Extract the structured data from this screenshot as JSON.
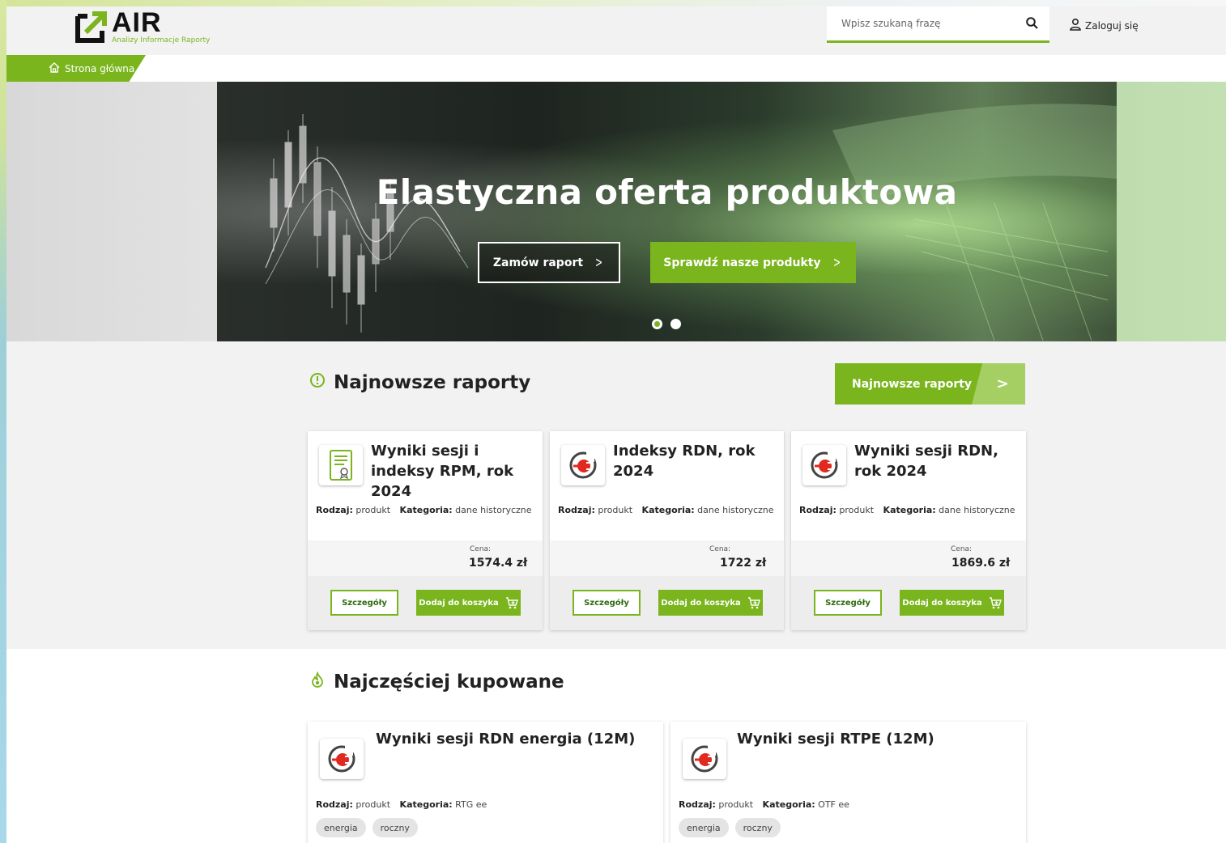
{
  "header": {
    "logo_name": "AIR",
    "logo_tagline": "Analizy Informacje Raporty",
    "search_placeholder": "Wpisz szukaną frazę",
    "login_label": "Zaloguj się"
  },
  "breadcrumb": {
    "home_label": "Strona główna"
  },
  "hero": {
    "title": "Elastyczna oferta produktowa",
    "button_outline": "Zamów raport",
    "button_green": "Sprawdź nasze produkty",
    "slides": 2,
    "active_slide": 1
  },
  "latest": {
    "title": "Najnowsze raporty",
    "button_label": "Najnowsze raporty",
    "cards": [
      {
        "title": "Wyniki sesji i indeksy RPM, rok 2024",
        "icon": "certificate-document-icon",
        "type_label": "Rodzaj:",
        "type_value": "produkt",
        "category_label": "Kategoria:",
        "category_value": "dane historyczne",
        "price_label": "Cena:",
        "price": "1574.4 zł",
        "details_label": "Szczegóły",
        "cart_label": "Dodaj do koszyka"
      },
      {
        "title": "Indeksy RDN, rok 2024",
        "icon": "power-plug-icon",
        "type_label": "Rodzaj:",
        "type_value": "produkt",
        "category_label": "Kategoria:",
        "category_value": "dane historyczne",
        "price_label": "Cena:",
        "price": "1722 zł",
        "details_label": "Szczegóły",
        "cart_label": "Dodaj do koszyka"
      },
      {
        "title": "Wyniki sesji RDN, rok 2024",
        "icon": "power-plug-icon",
        "type_label": "Rodzaj:",
        "type_value": "produkt",
        "category_label": "Kategoria:",
        "category_value": "dane historyczne",
        "price_label": "Cena:",
        "price": "1869.6 zł",
        "details_label": "Szczegóły",
        "cart_label": "Dodaj do koszyka"
      }
    ]
  },
  "popular": {
    "title": "Najczęściej kupowane",
    "cards": [
      {
        "title": "Wyniki sesji RDN energia (12M)",
        "icon": "power-plug-icon",
        "type_label": "Rodzaj:",
        "type_value": "produkt",
        "category_label": "Kategoria:",
        "category_value": "RTG ee",
        "tags": [
          "energia",
          "roczny"
        ]
      },
      {
        "title": "Wyniki sesji RTPE (12M)",
        "icon": "power-plug-icon",
        "type_label": "Rodzaj:",
        "type_value": "produkt",
        "category_label": "Kategoria:",
        "category_value": "OTF ee",
        "tags": [
          "energia",
          "roczny"
        ]
      }
    ]
  },
  "colors": {
    "brand_green": "#7ab51d",
    "light_green": "#a6cf63",
    "plug_red": "#e02a1f"
  }
}
